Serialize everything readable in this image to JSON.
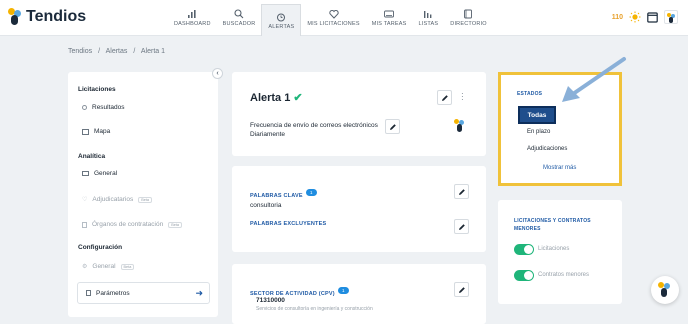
{
  "brand": {
    "name": "Tendios"
  },
  "nav": [
    {
      "label": "DASHBOARD",
      "icon": "bar-chart-icon"
    },
    {
      "label": "BUSCADOR",
      "icon": "search-icon"
    },
    {
      "label": "ALERTAS",
      "icon": "alarm-clock-icon"
    },
    {
      "label": "MIS LICITACIONES",
      "icon": "heart-icon"
    },
    {
      "label": "MIS TAREAS",
      "icon": "keyboard-icon"
    },
    {
      "label": "LISTAS",
      "icon": "list-bars-icon"
    },
    {
      "label": "DIRECTORIO",
      "icon": "book-icon"
    }
  ],
  "topright": {
    "coins": "110"
  },
  "breadcrumb": [
    "Tendios",
    "/",
    "Alertas",
    "/",
    "Alerta 1"
  ],
  "sidebar": {
    "licitaciones_title": "Licitaciones",
    "resultados": "Resultados",
    "mapa": "Mapa",
    "analitica_title": "Analítica",
    "general": "General",
    "adjudicatarios": "Adjudicatarios",
    "organos": "Órganos de contratación",
    "configuracion_title": "Configuración",
    "general2": "General",
    "parametros": "Parámetros",
    "beta": "Beta"
  },
  "alert": {
    "title": "Alerta 1",
    "freq_label": "Frecuencia de envío de correos electrónicos",
    "freq_value": "Diariamente"
  },
  "keywords": {
    "title": "PALABRAS CLAVE",
    "count": "1",
    "value": "consultoria",
    "excl_title": "PALABRAS EXCLUYENTES"
  },
  "sector": {
    "title": "SECTOR DE ACTIVIDAD (CPV)",
    "count": "1",
    "code": "71310000",
    "desc": "Servicios de consultoría en ingeniería y construcción"
  },
  "estados": {
    "title": "ESTADOS",
    "todas": "Todas",
    "en_plazo": "En plazo",
    "adjudicaciones": "Adjudicaciones",
    "mostrar": "Mostrar más"
  },
  "licit_menores": {
    "title_line1": "LICITACIONES Y CONTRATOS",
    "title_line2": "MENORES",
    "licitaciones": "Licitaciones",
    "contratos": "Contratos menores"
  },
  "colors": {
    "accent": "#1f5aa5",
    "highlight": "#f0c23a",
    "toggle": "#1fb57a",
    "arrow": "#8ab0d8"
  }
}
